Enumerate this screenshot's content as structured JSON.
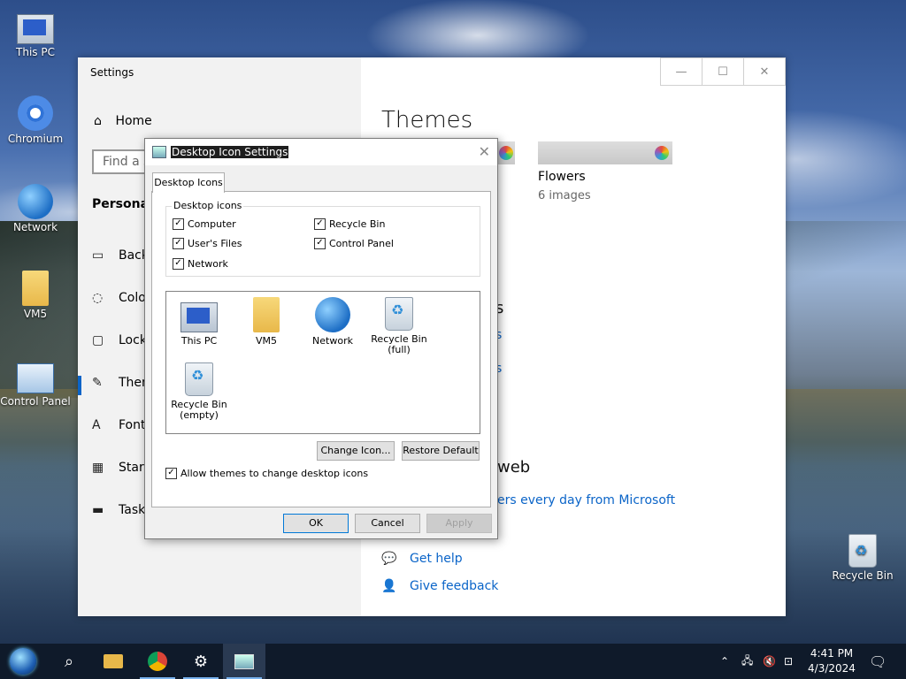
{
  "desktop": {
    "icons": [
      {
        "label": "This PC"
      },
      {
        "label": "Chromium"
      },
      {
        "label": "Network"
      },
      {
        "label": "VM5"
      },
      {
        "label": "Control Panel"
      },
      {
        "label": "Recycle Bin"
      }
    ]
  },
  "settings": {
    "title": "Settings",
    "window_buttons": {
      "minimize": "—",
      "maximize": "☐",
      "close": "✕"
    },
    "home": "Home",
    "search_placeholder": "Find a s",
    "section": "Personaliz",
    "nav": [
      {
        "label": "Back",
        "icon": "picture-icon"
      },
      {
        "label": "Colo",
        "icon": "palette-icon"
      },
      {
        "label": "Lock",
        "icon": "lock-screen-icon"
      },
      {
        "label": "Then",
        "icon": "themes-icon"
      },
      {
        "label": "Fonts",
        "icon": "fonts-icon"
      },
      {
        "label": "Start",
        "icon": "start-icon"
      },
      {
        "label": "Taskb",
        "icon": "taskbar-icon"
      }
    ],
    "heading": "Themes",
    "theme_name": "Flowers",
    "theme_images": "6 images",
    "fragments": {
      "s": "s",
      "link1": "s",
      "link2": "s",
      "web": "web",
      "ms_link": "ers every day from Microsoft"
    },
    "help": "Get help",
    "feedback": "Give feedback"
  },
  "dialog": {
    "title": "Desktop Icon Settings",
    "tab": "Desktop Icons",
    "group_label": "Desktop icons",
    "checkboxes": [
      {
        "label": "Computer",
        "checked": "✓"
      },
      {
        "label": "Recycle Bin",
        "checked": "✓"
      },
      {
        "label": "User's Files",
        "checked": "✓"
      },
      {
        "label": "Control Panel",
        "checked": "✓"
      },
      {
        "label": "Network",
        "checked": "✓"
      }
    ],
    "icon_items": [
      {
        "line1": "This PC",
        "line2": ""
      },
      {
        "line1": "VM5",
        "line2": ""
      },
      {
        "line1": "Network",
        "line2": ""
      },
      {
        "line1": "Recycle Bin",
        "line2": "(full)"
      },
      {
        "line1": "Recycle Bin",
        "line2": "(empty)"
      }
    ],
    "change_icon": "Change Icon...",
    "restore_default": "Restore Default",
    "allow_themes": "Allow themes to change desktop icons",
    "allow_checked": "✓",
    "ok": "OK",
    "cancel": "Cancel",
    "apply": "Apply"
  },
  "taskbar": {
    "time": "4:41 PM",
    "date": "4/3/2024",
    "tray_up": "⌃"
  },
  "colors": {
    "accent": "#0a64c8",
    "taskbar": "#0f1a2a"
  }
}
